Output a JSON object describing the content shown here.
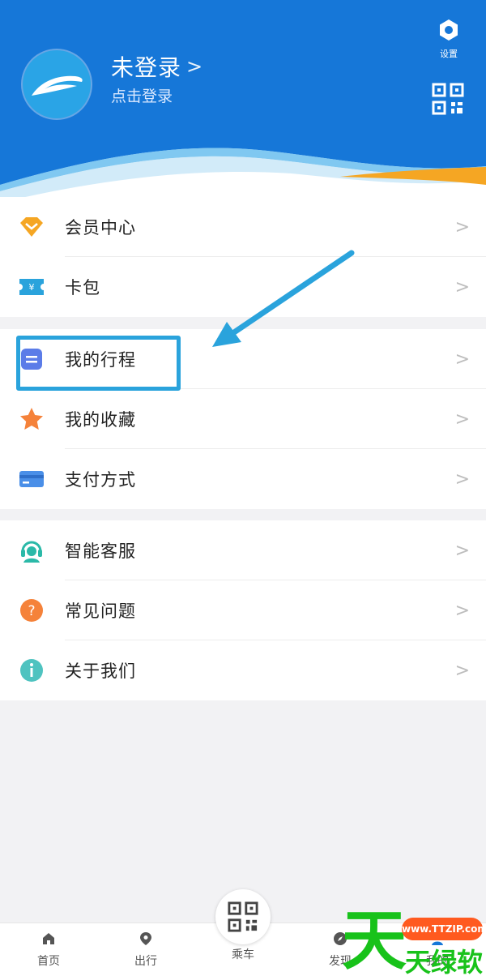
{
  "header": {
    "title": "未登录",
    "title_chevron": ">",
    "subtitle": "点击登录",
    "settings_label": "设置"
  },
  "menu": {
    "group1": [
      {
        "label": "会员中心",
        "icon": "diamond-icon"
      },
      {
        "label": "卡包",
        "icon": "ticket-icon"
      }
    ],
    "group2": [
      {
        "label": "我的行程",
        "icon": "itinerary-icon"
      },
      {
        "label": "我的收藏",
        "icon": "star-icon"
      },
      {
        "label": "支付方式",
        "icon": "card-icon"
      }
    ],
    "group3": [
      {
        "label": "智能客服",
        "icon": "headset-icon"
      },
      {
        "label": "常见问题",
        "icon": "question-icon"
      },
      {
        "label": "关于我们",
        "icon": "info-icon"
      }
    ],
    "arrow": ">"
  },
  "tabbar": {
    "home": "首页",
    "travel": "出行",
    "ride": "乘车",
    "discover": "发现",
    "mine": "我的"
  },
  "watermark": {
    "char": "天",
    "url": "www.TTZIP.com",
    "brand": "天绿软"
  },
  "colors": {
    "header_blue": "#1677d8",
    "accent_orange": "#f5a623",
    "highlight_blue": "#2aa3dc",
    "watermark_green": "#18c21a"
  }
}
